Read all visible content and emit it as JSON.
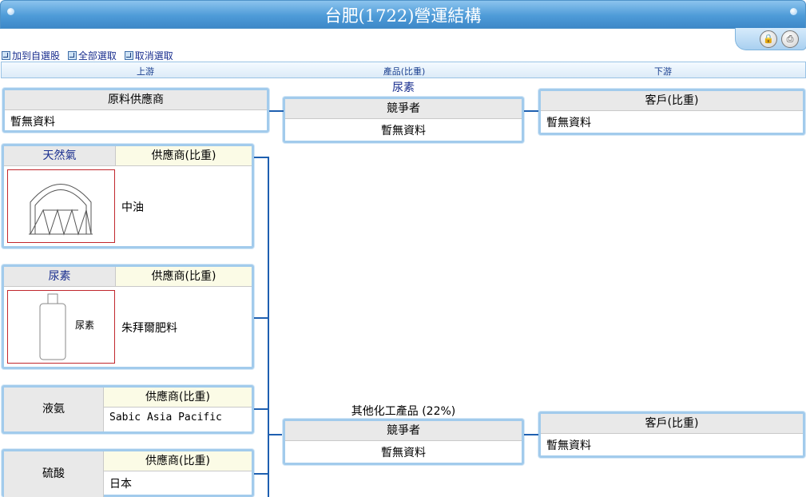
{
  "window": {
    "title": "台肥(1722)營運結構"
  },
  "actions": {
    "add_favorites": "加到自選股",
    "select_all": "全部選取",
    "deselect": "取消選取"
  },
  "columns": {
    "upstream": "上游",
    "product": "產品(比重)",
    "downstream": "下游"
  },
  "upstream_summary": {
    "header": "原料供應商",
    "value": "暫無資料"
  },
  "products": [
    {
      "name": "尿素",
      "competitor_header": "競爭者",
      "competitor_value": "暫無資料",
      "customer_header": "客戶(比重)",
      "customer_value": "暫無資料"
    },
    {
      "name": "其他化工產品 (22%)",
      "competitor_header": "競爭者",
      "competitor_value": "暫無資料",
      "customer_header": "客戶(比重)",
      "customer_value": "暫無資料"
    }
  ],
  "materials": [
    {
      "name": "天然氣",
      "supplier_header": "供應商(比重)",
      "supplier": "中油",
      "image": "gas-holder-icon"
    },
    {
      "name": "尿素",
      "supplier_header": "供應商(比重)",
      "supplier": "朱拜爾肥料",
      "image_text": "尿素",
      "image": "bottle-icon"
    },
    {
      "name": "液氨",
      "supplier_header": "供應商(比重)",
      "supplier": "Sabic Asia Pacific"
    },
    {
      "name": "硫酸",
      "supplier_header": "供應商(比重)",
      "supplier": "日本"
    }
  ],
  "colors": {
    "accent": "#4e9bd8",
    "border": "#a2cbec",
    "connector": "#1e5fb0",
    "link": "#1a2f8f"
  }
}
